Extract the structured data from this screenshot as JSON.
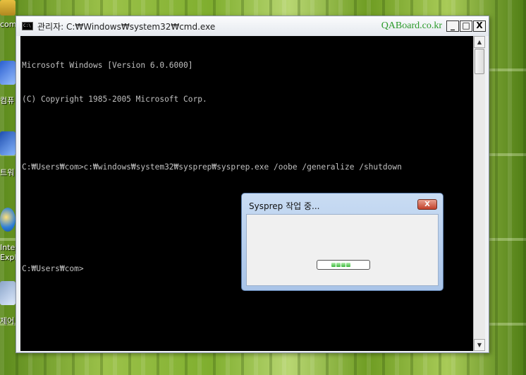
{
  "cmd_window": {
    "title": "관리자: C:₩Windows₩system32₩cmd.exe",
    "icon_label": "C:\\",
    "watermark": "QABoard.co.kr",
    "buttons": {
      "minimize": "_",
      "maximize": "□",
      "close": "X"
    },
    "lines": [
      "Microsoft Windows [Version 6.0.6000]",
      "(C) Copyright 1985-2005 Microsoft Corp.",
      "",
      "C:₩Users₩com>c:₩windows₩system32₩sysprep₩sysprep.exe /oobe /generalize /shutdown",
      "",
      "",
      "C:₩Users₩com>"
    ],
    "scrollbar": {
      "up_arrow": "▲",
      "down_arrow": "▼"
    }
  },
  "sysprep_dialog": {
    "title": "Sysprep 작업 중...",
    "close_label": "X",
    "progress_segments": 4
  },
  "desktop": {
    "icon_labels": [
      "com",
      "컴퓨",
      "트워",
      "Intern",
      "Explo",
      "제어"
    ]
  }
}
